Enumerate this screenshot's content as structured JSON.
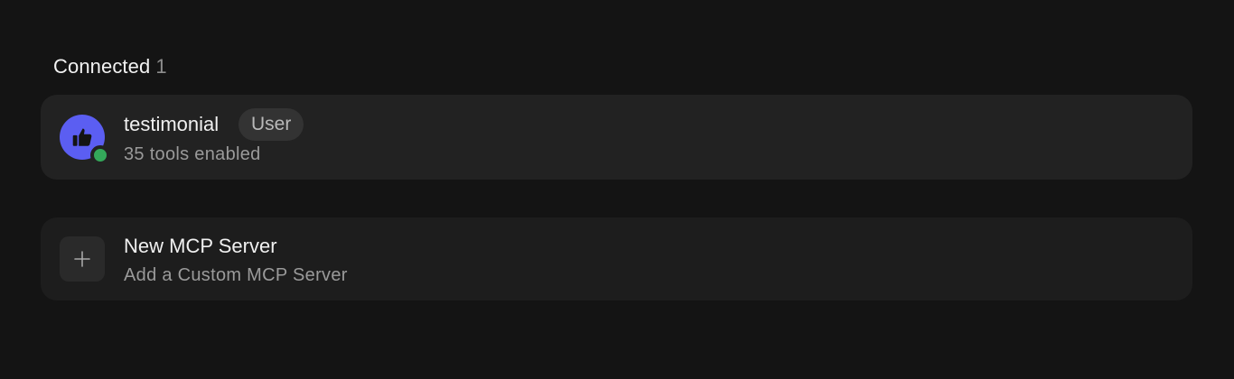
{
  "connected_section": {
    "title": "Connected",
    "count": "1"
  },
  "servers": [
    {
      "name": "testimonial",
      "badge": "User",
      "subtitle": "35 tools enabled",
      "icon": "thumbs-up-icon",
      "icon_bg": "#5b5ef2",
      "status": "connected",
      "status_color": "#34a85a"
    }
  ],
  "new_server": {
    "title": "New MCP Server",
    "subtitle": "Add a Custom MCP Server",
    "icon": "plus-icon"
  },
  "colors": {
    "background": "#141414",
    "card": "#222222",
    "accent": "#5b5ef2",
    "success": "#34a85a"
  }
}
